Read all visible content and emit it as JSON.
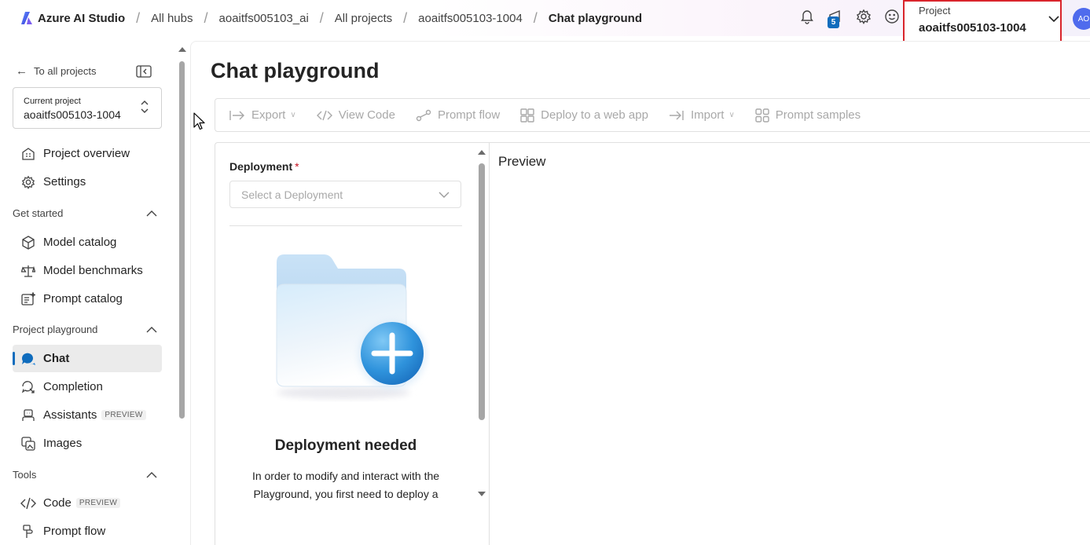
{
  "topbar": {
    "brand": "Azure AI Studio",
    "breadcrumbs": [
      "All hubs",
      "aoaitfs005103_ai",
      "All projects",
      "aoaitfs005103-1004",
      "Chat playground"
    ],
    "separator": "/",
    "notification_badge": "5",
    "project_selector": {
      "label": "Project",
      "value": "aoaitfs005103-1004"
    },
    "avatar_initials": "AO"
  },
  "sidebar": {
    "back_link": "To all projects",
    "current_project": {
      "label": "Current project",
      "value": "aoaitfs005103-1004"
    },
    "top_items": [
      {
        "label": "Project overview",
        "icon": "building-icon"
      },
      {
        "label": "Settings",
        "icon": "gear-icon"
      }
    ],
    "sections": {
      "get_started": {
        "title": "Get started",
        "items": [
          {
            "label": "Model catalog",
            "icon": "cube-icon"
          },
          {
            "label": "Model benchmarks",
            "icon": "scale-icon"
          },
          {
            "label": "Prompt catalog",
            "icon": "prompt-catalog-icon"
          }
        ]
      },
      "playground": {
        "title": "Project playground",
        "items": [
          {
            "label": "Chat",
            "icon": "chat-icon",
            "active": true
          },
          {
            "label": "Completion",
            "icon": "completion-icon"
          },
          {
            "label": "Assistants",
            "icon": "assistant-icon",
            "tag": "PREVIEW"
          },
          {
            "label": "Images",
            "icon": "images-icon"
          }
        ]
      },
      "tools": {
        "title": "Tools",
        "items": [
          {
            "label": "Code",
            "icon": "code-icon",
            "tag": "PREVIEW"
          },
          {
            "label": "Prompt flow",
            "icon": "prompt-flow-icon"
          }
        ]
      }
    }
  },
  "main": {
    "title": "Chat playground",
    "toolbar": {
      "export": "Export",
      "view_code": "View Code",
      "prompt_flow": "Prompt flow",
      "deploy": "Deploy to a web app",
      "import": "Import",
      "prompt_samples": "Prompt samples"
    },
    "setup": {
      "deployment_label": "Deployment",
      "required_mark": "*",
      "deployment_placeholder": "Select a Deployment",
      "empty_title": "Deployment needed",
      "empty_desc_line1": "In order to modify and interact with the",
      "empty_desc_line2": "Playground, you first need to deploy a"
    },
    "preview": {
      "title": "Preview"
    }
  },
  "colors": {
    "accent": "#0f6cbd",
    "selector_border": "#d9252c",
    "disabled_text": "#a8a8a8",
    "required": "#c50f1f"
  }
}
